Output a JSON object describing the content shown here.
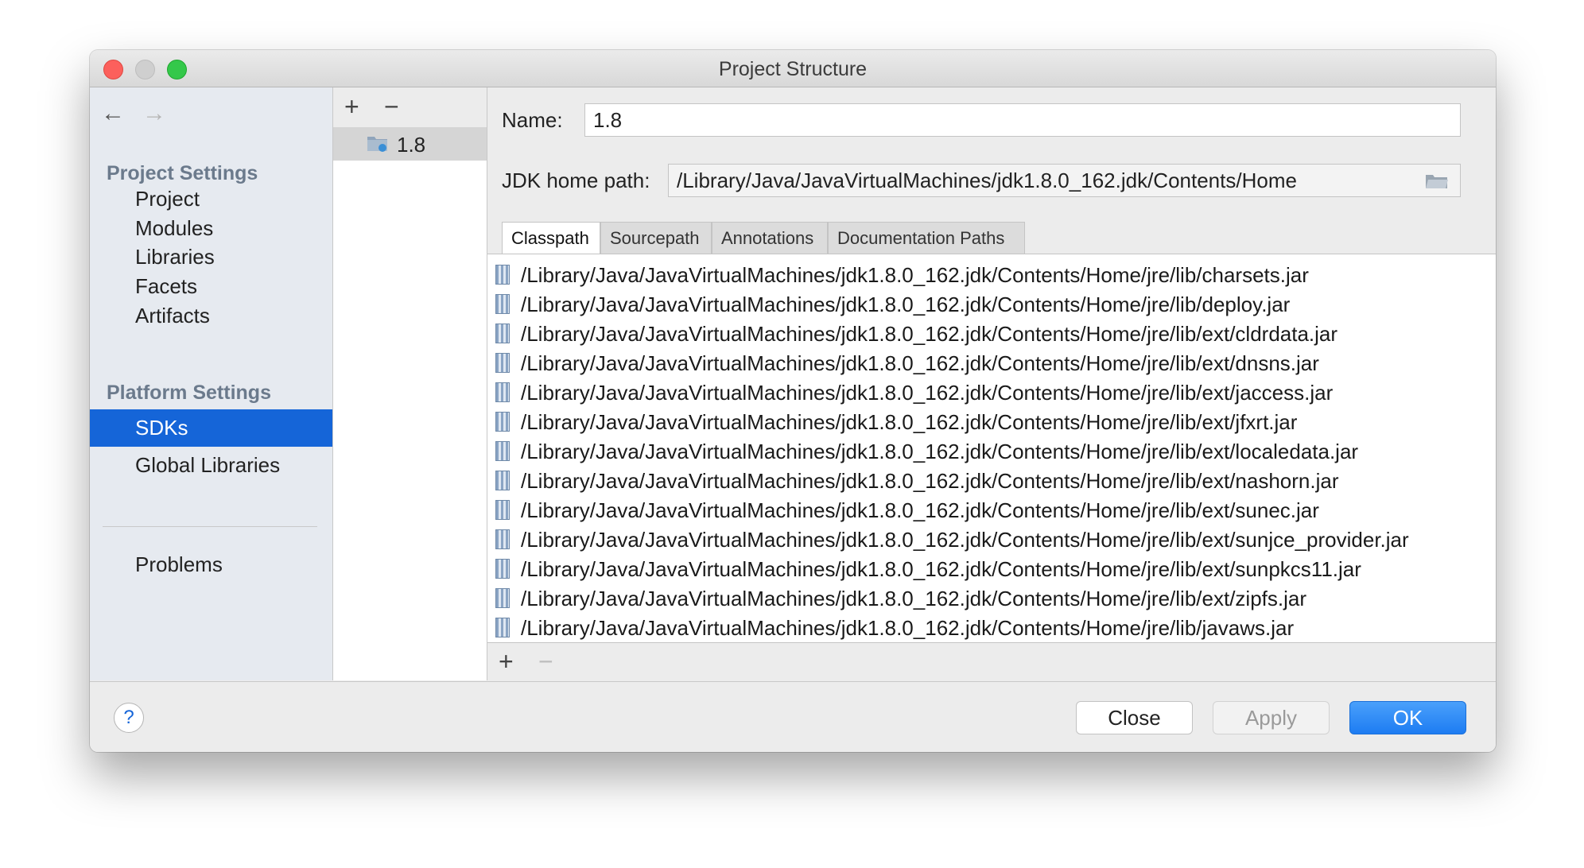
{
  "window": {
    "title": "Project Structure"
  },
  "nav": {
    "back_icon": "←",
    "forward_icon": "→"
  },
  "sidebar": {
    "project_settings_title": "Project Settings",
    "project_items": [
      "Project",
      "Modules",
      "Libraries",
      "Facets",
      "Artifacts"
    ],
    "platform_settings_title": "Platform Settings",
    "platform_items": [
      "SDKs",
      "Global Libraries"
    ],
    "selected": "SDKs",
    "problems": "Problems"
  },
  "sdk_list": {
    "add_icon": "+",
    "remove_icon": "−",
    "items": [
      "1.8"
    ]
  },
  "details": {
    "name_label": "Name:",
    "name_value": "1.8",
    "home_label": "JDK home path:",
    "home_value": "/Library/Java/JavaVirtualMachines/jdk1.8.0_162.jdk/Contents/Home",
    "tabs": [
      "Classpath",
      "Sourcepath",
      "Annotations",
      "Documentation Paths"
    ],
    "active_tab": "Classpath",
    "classpath": [
      "/Library/Java/JavaVirtualMachines/jdk1.8.0_162.jdk/Contents/Home/jre/lib/charsets.jar",
      "/Library/Java/JavaVirtualMachines/jdk1.8.0_162.jdk/Contents/Home/jre/lib/deploy.jar",
      "/Library/Java/JavaVirtualMachines/jdk1.8.0_162.jdk/Contents/Home/jre/lib/ext/cldrdata.jar",
      "/Library/Java/JavaVirtualMachines/jdk1.8.0_162.jdk/Contents/Home/jre/lib/ext/dnsns.jar",
      "/Library/Java/JavaVirtualMachines/jdk1.8.0_162.jdk/Contents/Home/jre/lib/ext/jaccess.jar",
      "/Library/Java/JavaVirtualMachines/jdk1.8.0_162.jdk/Contents/Home/jre/lib/ext/jfxrt.jar",
      "/Library/Java/JavaVirtualMachines/jdk1.8.0_162.jdk/Contents/Home/jre/lib/ext/localedata.jar",
      "/Library/Java/JavaVirtualMachines/jdk1.8.0_162.jdk/Contents/Home/jre/lib/ext/nashorn.jar",
      "/Library/Java/JavaVirtualMachines/jdk1.8.0_162.jdk/Contents/Home/jre/lib/ext/sunec.jar",
      "/Library/Java/JavaVirtualMachines/jdk1.8.0_162.jdk/Contents/Home/jre/lib/ext/sunjce_provider.jar",
      "/Library/Java/JavaVirtualMachines/jdk1.8.0_162.jdk/Contents/Home/jre/lib/ext/sunpkcs11.jar",
      "/Library/Java/JavaVirtualMachines/jdk1.8.0_162.jdk/Contents/Home/jre/lib/ext/zipfs.jar",
      "/Library/Java/JavaVirtualMachines/jdk1.8.0_162.jdk/Contents/Home/jre/lib/javaws.jar"
    ],
    "add_icon": "+",
    "remove_icon": "−"
  },
  "footer": {
    "help_icon": "?",
    "close_label": "Close",
    "apply_label": "Apply",
    "ok_label": "OK"
  },
  "colors": {
    "selection": "#1565d8",
    "ok_button": "#1d7cf2",
    "traffic_close": "#fc605c",
    "traffic_max": "#34c84a"
  }
}
